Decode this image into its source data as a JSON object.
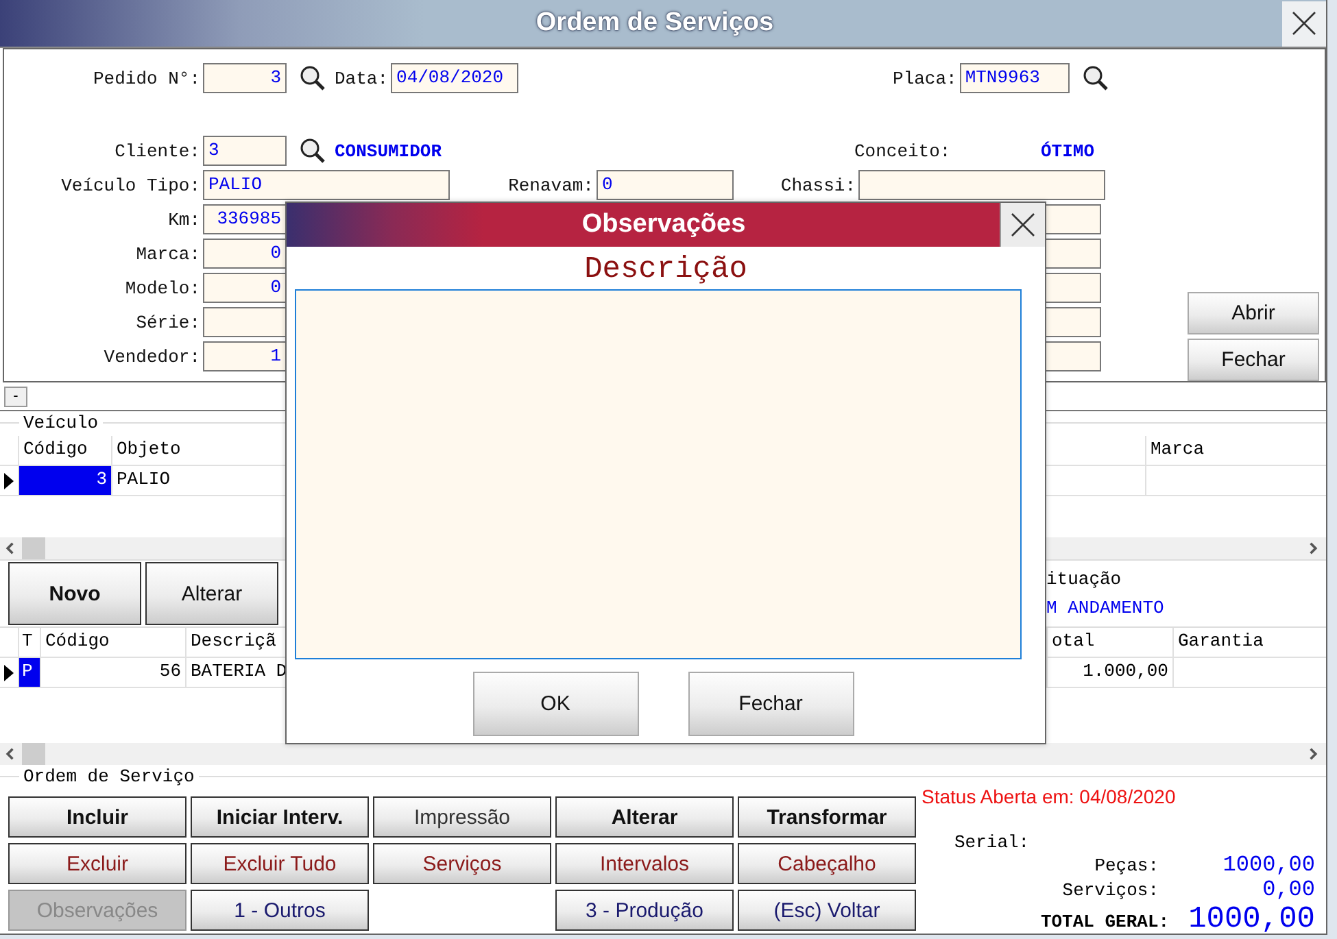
{
  "window": {
    "title": "Ordem de Serviços"
  },
  "header_form": {
    "pedido": {
      "label": "Pedido N°:",
      "value": "3"
    },
    "data": {
      "label": "Data:",
      "value": "04/08/2020"
    },
    "placa": {
      "label": "Placa:",
      "value": "MTN9963"
    },
    "cliente": {
      "label": "Cliente:",
      "value": "3",
      "name": "CONSUMIDOR"
    },
    "conceito": {
      "label": "Conceito:",
      "value": "ÓTIMO"
    },
    "veiculo_tipo": {
      "label": "Veículo Tipo:",
      "value": "PALIO"
    },
    "renavam": {
      "label": "Renavam:",
      "value": "0"
    },
    "chassi": {
      "label": "Chassi:"
    },
    "fields": [
      {
        "label": "Km:",
        "value": "336985"
      },
      {
        "label": "Marca:",
        "value": "0"
      },
      {
        "label": "Modelo:",
        "value": "0"
      },
      {
        "label": "Série:"
      },
      {
        "label": "Vendedor:",
        "value": "1"
      }
    ],
    "buttons": [
      "Abrir",
      "Fechar"
    ]
  },
  "collapse_button": "-",
  "vehicle_grid": {
    "title": "Veículo",
    "columns": [
      "Código",
      "Objeto",
      "Marca"
    ],
    "rows": [
      {
        "codigo": "3",
        "objeto": "PALIO",
        "selected": true
      }
    ]
  },
  "item_actions": [
    "Novo",
    "Alterar"
  ],
  "situacao": {
    "label": "ituação",
    "value": "M ANDAMENTO"
  },
  "items_grid": {
    "columns": [
      "T",
      "Código",
      "Descriçã",
      "otal",
      "Garantia"
    ],
    "rows": [
      {
        "t": "P",
        "codigo": "56",
        "descricao": "BATERIA D",
        "total": "1.000,00",
        "selected": true
      }
    ]
  },
  "os_group": {
    "title": "Ordem de Serviço",
    "button_rows": [
      [
        {
          "label": "Incluir",
          "kind": "bold",
          "disabled": false
        },
        {
          "label": "Iniciar Interv.",
          "kind": "bold",
          "disabled": false
        },
        {
          "label": "Impressão",
          "kind": "normal",
          "disabled": false
        },
        {
          "label": "Alterar",
          "kind": "bold",
          "disabled": false
        },
        {
          "label": "Transformar",
          "kind": "bold",
          "disabled": false
        }
      ],
      [
        {
          "label": "Excluir",
          "kind": "red",
          "disabled": false
        },
        {
          "label": "Excluir Tudo",
          "kind": "red",
          "disabled": false
        },
        {
          "label": "Serviços",
          "kind": "red",
          "disabled": false
        },
        {
          "label": "Intervalos",
          "kind": "red",
          "disabled": false
        },
        {
          "label": "Cabeçalho",
          "kind": "red",
          "disabled": false
        }
      ],
      [
        {
          "label": "Observações",
          "kind": "normal",
          "disabled": true
        },
        {
          "label": "1 - Outros",
          "kind": "blue",
          "disabled": false
        },
        {
          "label": "3 - Produção",
          "kind": "blue",
          "disabled": false
        },
        {
          "label": "(Esc) Voltar",
          "kind": "blue",
          "disabled": false
        }
      ]
    ]
  },
  "status": "Status Aberta em: 04/08/2020",
  "totals": {
    "serial_label": "Serial:",
    "rows": [
      {
        "label": "Peças:",
        "value": "1000,00"
      },
      {
        "label": "Serviços:",
        "value": "0,00"
      }
    ],
    "total": {
      "label": "TOTAL GERAL:",
      "value": "1000,00"
    }
  },
  "dialog": {
    "title": "Observações",
    "heading": "Descrição",
    "buttons": [
      "OK",
      "Fechar"
    ]
  }
}
